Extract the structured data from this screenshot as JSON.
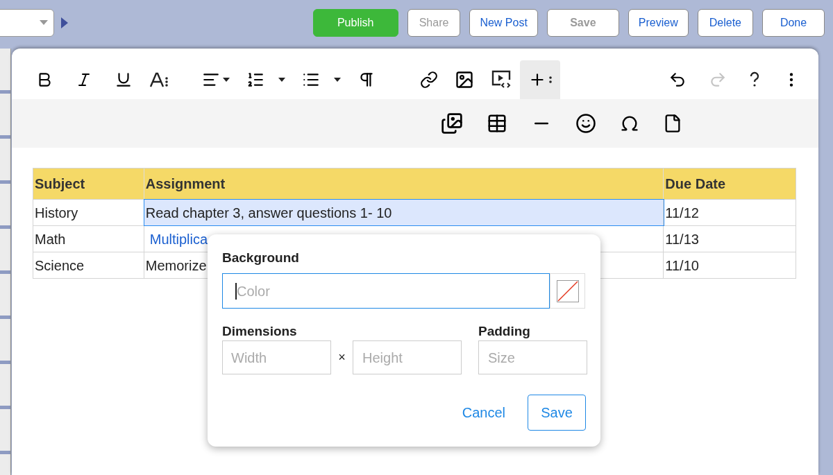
{
  "top_bar": {
    "buttons": [
      {
        "label": "Publish",
        "kind": "primary",
        "disabled": false
      },
      {
        "label": "Share",
        "kind": "default",
        "disabled": true
      },
      {
        "label": "New Post",
        "kind": "default",
        "disabled": false
      },
      {
        "label": "Save",
        "kind": "default",
        "disabled": true
      },
      {
        "label": "Preview",
        "kind": "default",
        "disabled": false
      },
      {
        "label": "Delete",
        "kind": "default",
        "disabled": false
      },
      {
        "label": "Done",
        "kind": "default",
        "disabled": false
      }
    ]
  },
  "toolbar": {
    "insert_expanded": true,
    "redo_disabled": true
  },
  "table": {
    "columns": [
      "Subject",
      "Assignment",
      "Due Date"
    ],
    "rows": [
      {
        "cells": [
          {
            "text": "History",
            "kind": "text",
            "selected": false
          },
          {
            "text": "Read chapter 3, answer questions 1- 10",
            "kind": "text",
            "selected": true
          },
          {
            "text": "11/12",
            "kind": "text",
            "selected": false
          }
        ]
      },
      {
        "cells": [
          {
            "text": "Math",
            "kind": "text",
            "selected": false
          },
          {
            "text": "Multiplica",
            "kind": "link",
            "selected": false
          },
          {
            "text": "11/13",
            "kind": "text",
            "selected": false
          }
        ]
      },
      {
        "cells": [
          {
            "text": "Science",
            "kind": "text",
            "selected": false
          },
          {
            "text": "Memorize",
            "kind": "text",
            "selected": false
          },
          {
            "text": "11/10",
            "kind": "text",
            "selected": false
          }
        ]
      }
    ]
  },
  "popup": {
    "background_label": "Background",
    "color_placeholder": "Color",
    "dimensions_label": "Dimensions",
    "width_placeholder": "Width",
    "times": "×",
    "height_placeholder": "Height",
    "padding_label": "Padding",
    "size_placeholder": "Size",
    "cancel": "Cancel",
    "save": "Save"
  }
}
